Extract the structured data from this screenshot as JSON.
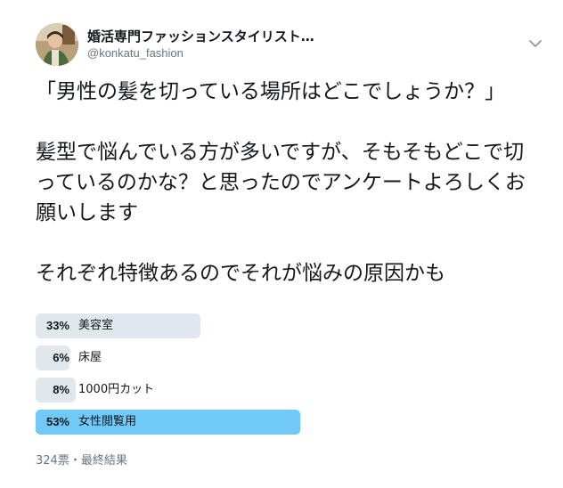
{
  "user": {
    "name": "婚活専門ファッションスタイリスト…",
    "handle": "@konkatu_fashion"
  },
  "tweet": {
    "text": "「男性の髪を切っている場所はどこでしょうか？」\n\n髪型で悩んでいる方が多いですが、そもそもどこで切っているのかな？と思ったのでアンケートよろしくお願いします\n\nそれぞれ特徴あるのでそれが悩みの原因かも"
  },
  "poll": {
    "options": [
      {
        "pct_label": "33%",
        "label": "美容室",
        "percent": 33,
        "winner": false
      },
      {
        "pct_label": "6%",
        "label": "床屋",
        "percent": 6,
        "winner": false
      },
      {
        "pct_label": "8%",
        "label": "1000円カット",
        "percent": 8,
        "winner": false
      },
      {
        "pct_label": "53%",
        "label": "女性閲覧用",
        "percent": 53,
        "winner": true
      }
    ],
    "footer": "324票・最終結果",
    "colors": {
      "bar": "#e1e8ed",
      "winner_bar": "#71c9f8"
    }
  },
  "icons": {
    "menu": "chevron-down-icon",
    "avatar": "avatar"
  }
}
